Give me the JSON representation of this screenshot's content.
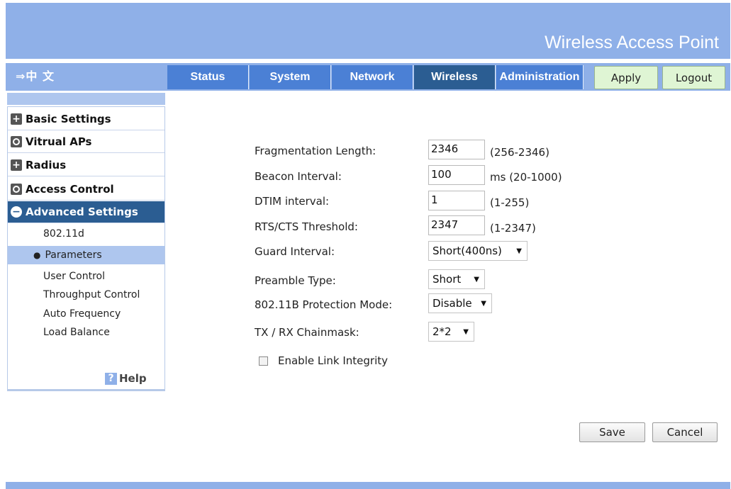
{
  "header": {
    "title": "Wireless Access Point"
  },
  "nav": {
    "language": "⇒中 文",
    "tabs": [
      {
        "label": "Status"
      },
      {
        "label": "System"
      },
      {
        "label": "Network"
      },
      {
        "label": "Wireless"
      },
      {
        "label": "Administration"
      }
    ],
    "active_tab": "Wireless",
    "apply_label": "Apply",
    "logout_label": "Logout"
  },
  "sidebar": {
    "sections": [
      {
        "label": "Basic Settings",
        "icon": "plus-icon"
      },
      {
        "label": "Vitrual APs",
        "icon": "circle-icon"
      },
      {
        "label": "Radius",
        "icon": "plus-icon"
      },
      {
        "label": "Access Control",
        "icon": "circle-icon"
      },
      {
        "label": "Advanced Settings",
        "icon": "minus-icon"
      }
    ],
    "sub_items": [
      {
        "label": "802.11d"
      },
      {
        "label": "Parameters"
      },
      {
        "label": "User Control"
      },
      {
        "label": "Throughput Control"
      },
      {
        "label": "Auto Frequency"
      },
      {
        "label": "Load Balance"
      }
    ],
    "active_sub": "Parameters",
    "help_label": "Help"
  },
  "form": {
    "fragmentation": {
      "label": "Fragmentation Length:",
      "value": "2346",
      "hint": "(256-2346)"
    },
    "beacon": {
      "label": "Beacon Interval:",
      "value": "100",
      "hint": "ms (20-1000)"
    },
    "dtim": {
      "label": "DTIM interval:",
      "value": "1",
      "hint": "(1-255)"
    },
    "rts": {
      "label": "RTS/CTS Threshold:",
      "value": "2347",
      "hint": "(1-2347)"
    },
    "guard": {
      "label": "Guard Interval:",
      "value": "Short(400ns)"
    },
    "preamble": {
      "label": "Preamble Type:",
      "value": "Short"
    },
    "protection": {
      "label": "802.11B Protection Mode:",
      "value": "Disable"
    },
    "chainmask": {
      "label": "TX / RX Chainmask:",
      "value": "2*2"
    },
    "link_integrity": {
      "label": "Enable Link Integrity",
      "checked": false
    }
  },
  "actions": {
    "save_label": "Save",
    "cancel_label": "Cancel"
  },
  "colors": {
    "header_bg": "#8fb0e8",
    "tab_bg": "#4b80d5",
    "tab_active_bg": "#2b5d92",
    "button_green": "#dff5d4",
    "sidebar_highlight": "#aec6ee"
  }
}
